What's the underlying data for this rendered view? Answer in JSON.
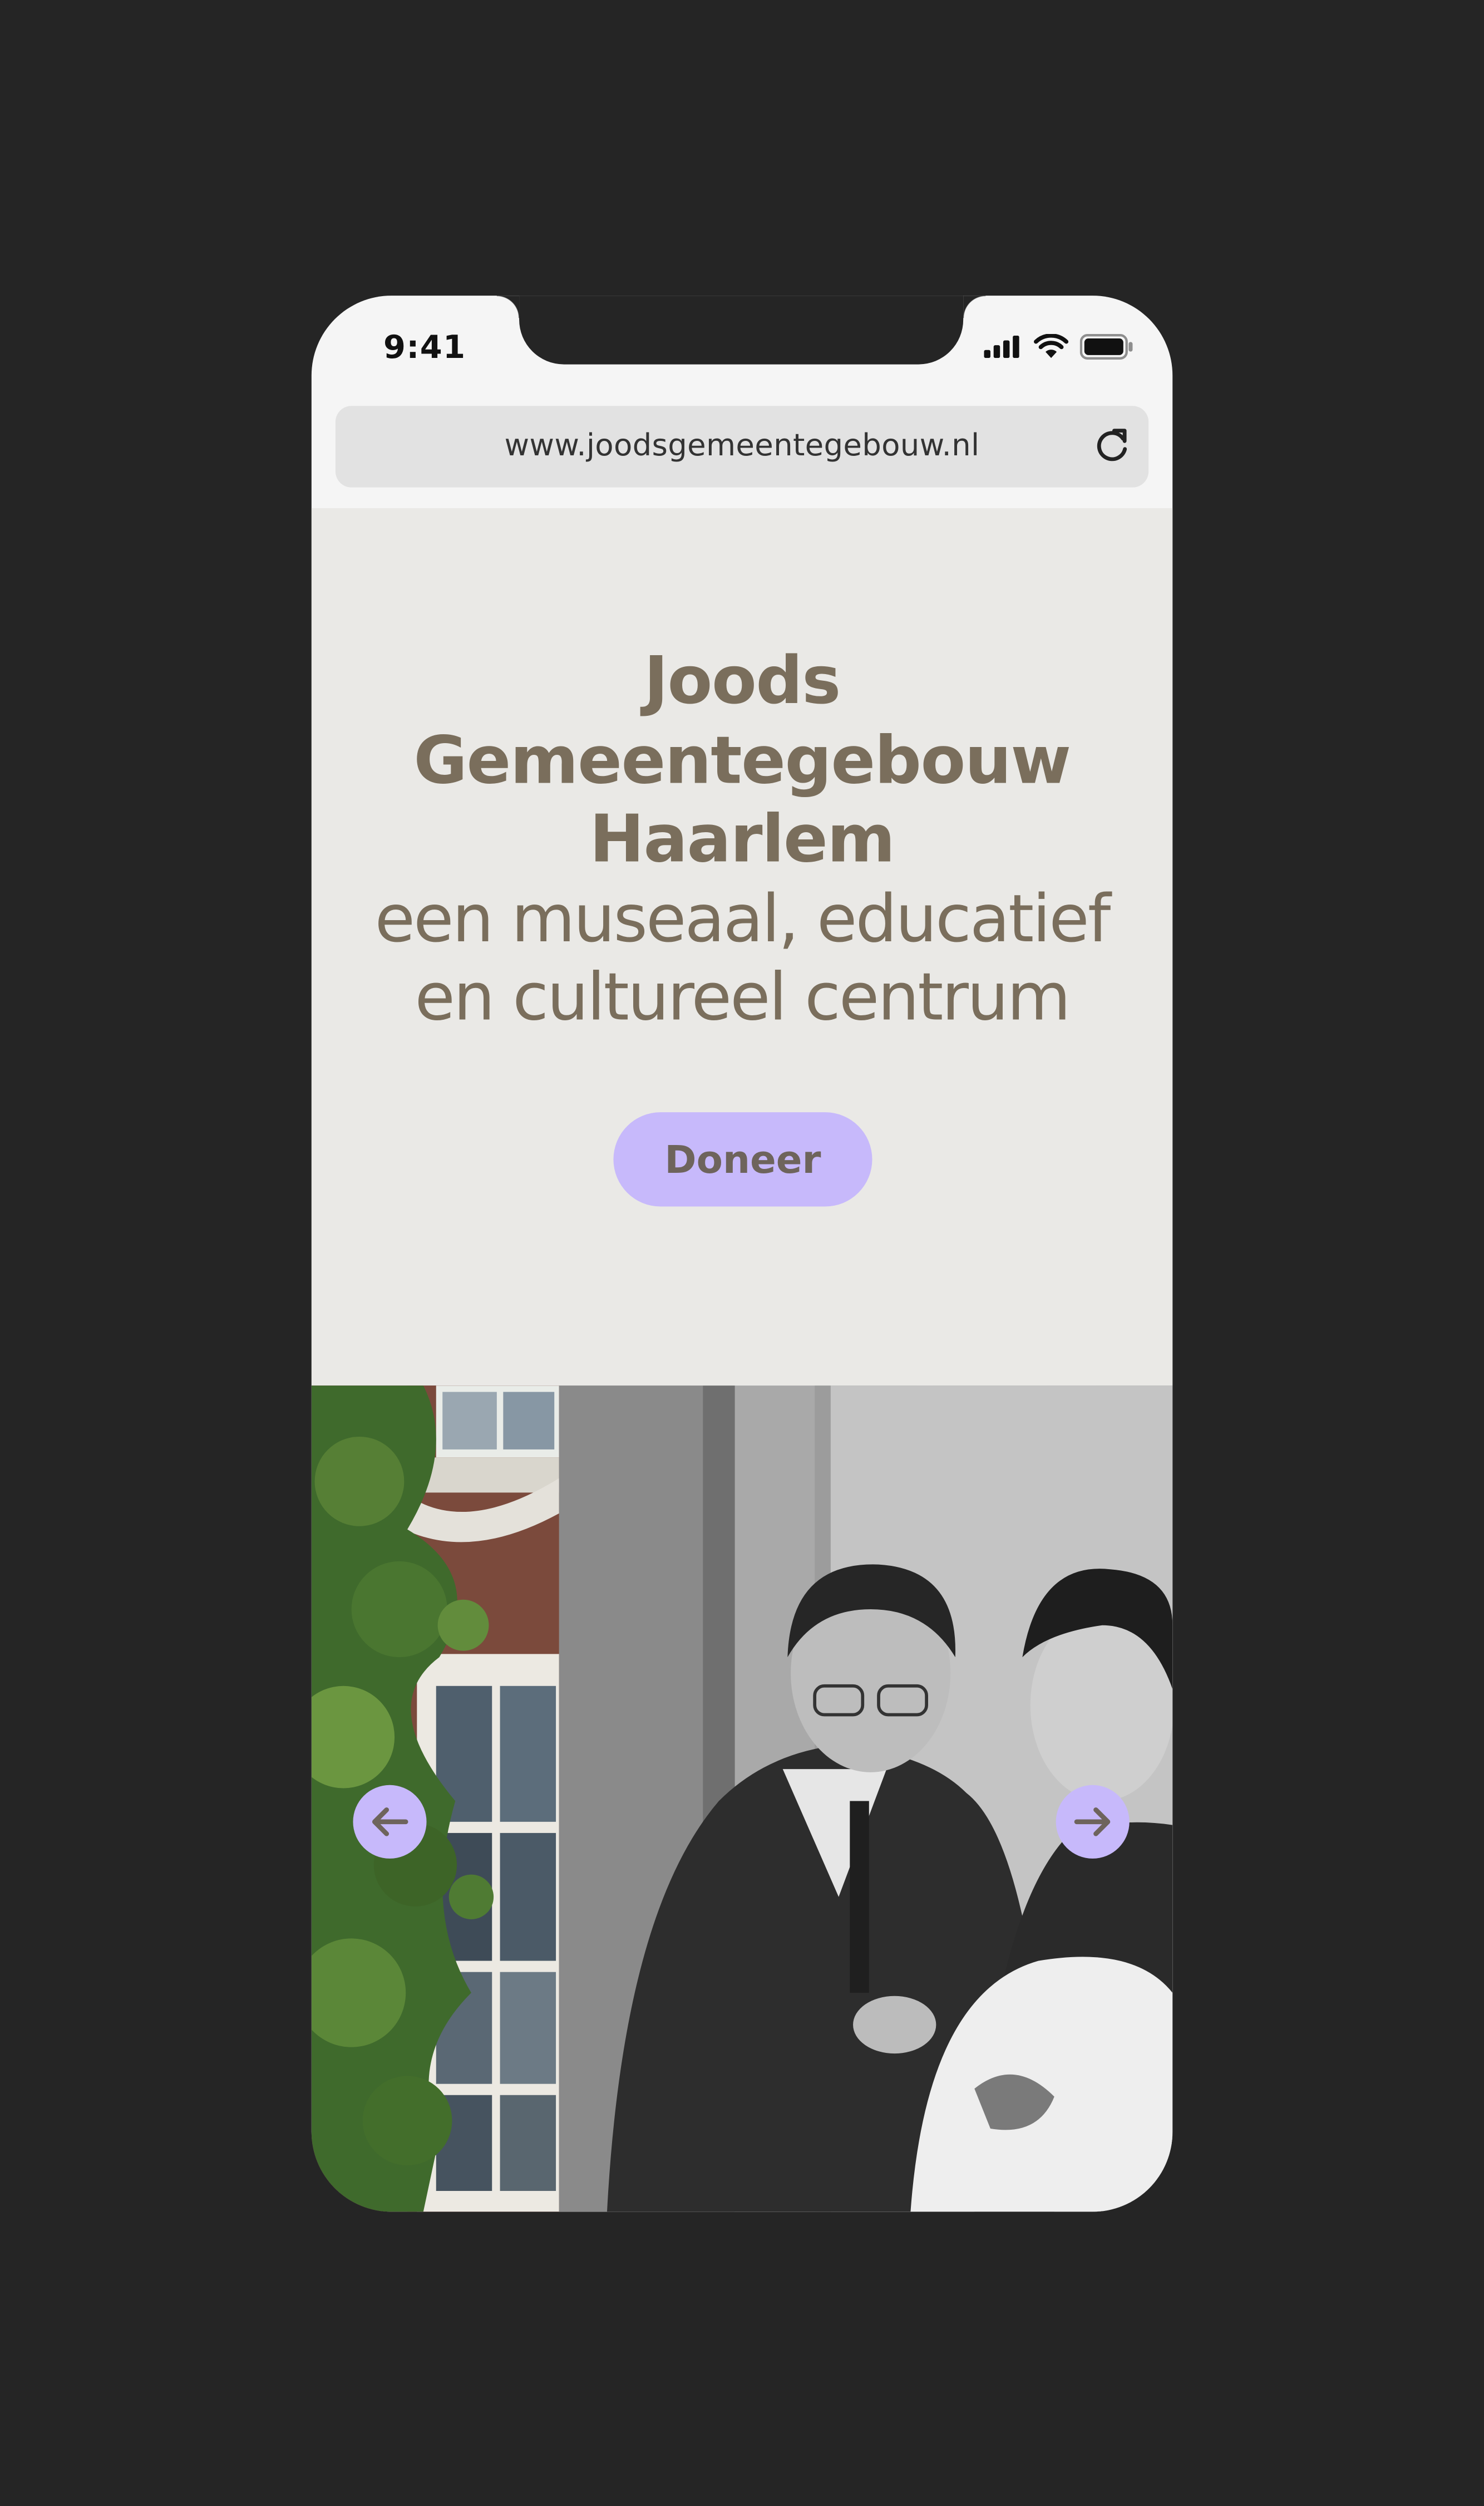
{
  "status_bar": {
    "time": "9:41",
    "icons": [
      "signal-icon",
      "wifi-icon",
      "battery-icon"
    ]
  },
  "browser": {
    "url": "www.joodsgemeentegebouw.nl",
    "reload_icon": "reload-icon"
  },
  "hero": {
    "title_lines": [
      "Joods",
      "Gemeentegebouw",
      "Haarlem"
    ],
    "subtitle_lines": [
      "een museaal, educatief",
      "en cultureel centrum"
    ],
    "donate_label": "Doneer"
  },
  "carousel": {
    "prev_icon": "arrow-left-icon",
    "next_icon": "arrow-right-icon"
  },
  "colors": {
    "background": "#252525",
    "hero_bg": "#eae9e6",
    "text_brown": "#7a6e5c",
    "accent_lavender": "#c7b9fb"
  }
}
